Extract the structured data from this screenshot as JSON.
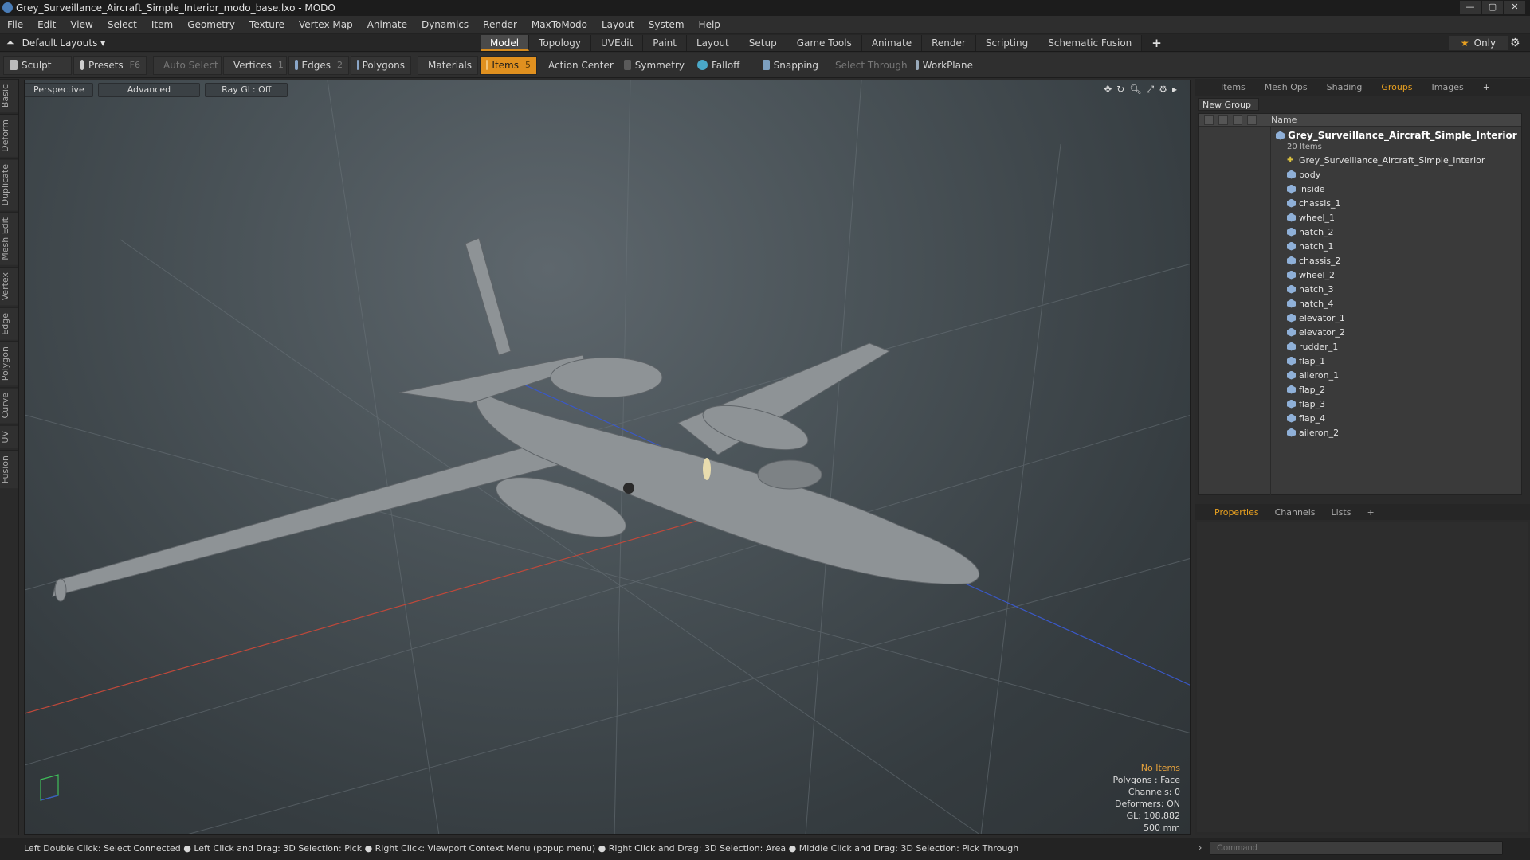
{
  "window": {
    "title": "Grey_Surveillance_Aircraft_Simple_Interior_modo_base.lxo - MODO",
    "buttons": [
      "—",
      "▢",
      "✕"
    ]
  },
  "menu": [
    "File",
    "Edit",
    "View",
    "Select",
    "Item",
    "Geometry",
    "Texture",
    "Vertex Map",
    "Animate",
    "Dynamics",
    "Render",
    "MaxToModo",
    "Layout",
    "System",
    "Help"
  ],
  "layout": {
    "dropdown": "Default Layouts ▾",
    "only_label": "Only"
  },
  "main_tabs": [
    "Model",
    "Topology",
    "UVEdit",
    "Paint",
    "Layout",
    "Setup",
    "Game Tools",
    "Animate",
    "Render",
    "Scripting",
    "Schematic Fusion"
  ],
  "main_tab_active": "Model",
  "toolbar": {
    "sculpt": "Sculpt",
    "presets": "Presets",
    "presets_key": "F6",
    "auto_select": "Auto Select",
    "vertices": "Vertices",
    "vertices_key": "1",
    "edges": "Edges",
    "edges_key": "2",
    "polygons": "Polygons",
    "materials": "Materials",
    "items": "Items",
    "items_key": "5",
    "action_center": "Action Center",
    "symmetry": "Symmetry",
    "falloff": "Falloff",
    "snapping": "Snapping",
    "select_through": "Select Through",
    "workplane": "WorkPlane"
  },
  "left_tabs": [
    "Basic",
    "Deform",
    "Duplicate",
    "Mesh Edit",
    "Vertex",
    "Edge",
    "Polygon",
    "Curve",
    "UV",
    "Fusion"
  ],
  "viewport": {
    "view": "Perspective",
    "shading": "Advanced",
    "raygl": "Ray GL: Off",
    "info": {
      "selection": "No Items",
      "polygons": "Polygons : Face",
      "channels": "Channels: 0",
      "deformers": "Deformers: ON",
      "gl": "GL: 108,882",
      "scale": "500 mm"
    }
  },
  "right_tabs": [
    "Items",
    "Mesh Ops",
    "Shading",
    "Groups",
    "Images"
  ],
  "right_tab_active": "Groups",
  "groups": {
    "new_group": "New Group",
    "name_header": "Name",
    "group_name": "Grey_Surveillance_Aircraft_Simple_Interior",
    "group_count": "20 Items",
    "items": [
      "Grey_Surveillance_Aircraft_Simple_Interior",
      "body",
      "inside",
      "chassis_1",
      "wheel_1",
      "hatch_2",
      "hatch_1",
      "chassis_2",
      "wheel_2",
      "hatch_3",
      "hatch_4",
      "elevator_1",
      "elevator_2",
      "rudder_1",
      "flap_1",
      "aileron_1",
      "flap_2",
      "flap_3",
      "flap_4",
      "aileron_2"
    ]
  },
  "prop_tabs": [
    "Properties",
    "Channels",
    "Lists"
  ],
  "prop_tab_active": "Properties",
  "status": "Left Double Click: Select Connected ● Left Click and Drag: 3D Selection: Pick ● Right Click: Viewport Context Menu (popup menu) ● Right Click and Drag: 3D Selection: Area ● Middle Click and Drag: 3D Selection: Pick Through",
  "command_placeholder": "Command",
  "colors": {
    "accent": "#e0901f",
    "x_axis": "#d04a3a",
    "z_axis": "#3a5fd0"
  }
}
